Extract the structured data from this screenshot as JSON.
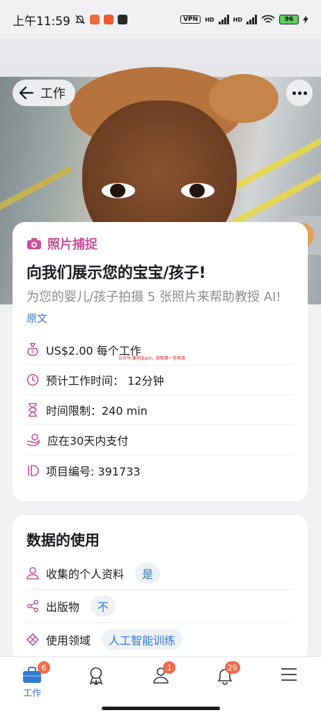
{
  "status_bar": {
    "time": "上午11:59",
    "vpn_label": "VPN",
    "network_1": "HD",
    "network_2": "HD",
    "battery": "96"
  },
  "header": {
    "back_label": "工作"
  },
  "task": {
    "category": "照片捕捉",
    "title": "向我们展示您的宝宝/孩子!",
    "subtitle": "为您的婴儿/孩子拍摄 5 张照片来帮助教授 AI!",
    "original_link": "原文",
    "watermark": "公众号:爱创业pro，获取第一手项目",
    "info": {
      "pay": "US$2.00 每个工作",
      "duration": "预计工作时间：  12分钟",
      "limit": "时间限制：240 min",
      "payment": "应在30天内支付",
      "project": "项目编号: 391733"
    }
  },
  "data_usage": {
    "title": "数据的使用",
    "personal_label": "收集的个人资料",
    "personal_value": "是",
    "publication_label": "出版物",
    "publication_value": "不",
    "field_label": "使用领域",
    "field_value": "人工智能训练"
  },
  "nav": {
    "work_label": "工作",
    "work_badge": "6",
    "profile_badge": "1",
    "notify_badge": "29"
  },
  "colors": {
    "accent": "#c8509a",
    "link": "#2f7bd0",
    "badge": "#ec6d4d"
  }
}
